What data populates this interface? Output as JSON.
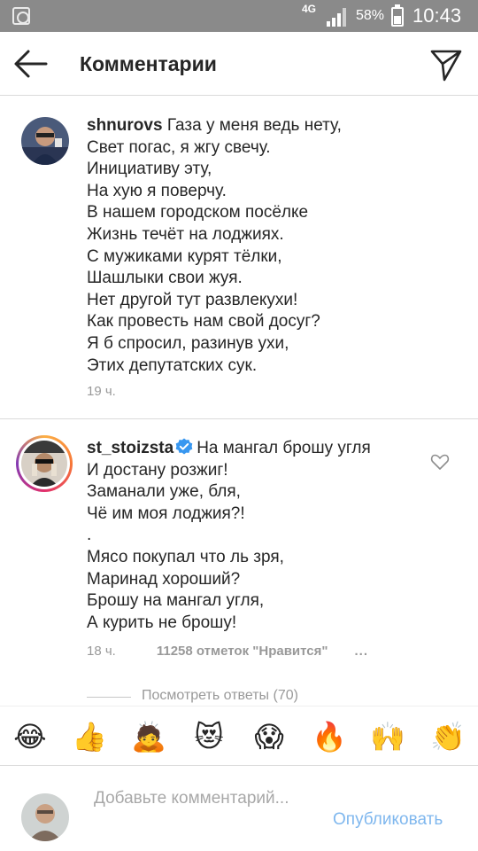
{
  "status_bar": {
    "network": "4G",
    "battery_percent": "58%",
    "time": "10:43"
  },
  "header": {
    "title": "Комментарии"
  },
  "comments": [
    {
      "username": "shnurovs",
      "text": "Газа у меня ведь нету,",
      "body": "Свет погас, я жгу свечу.\nИнициативу эту,\nНа хую я поверчу.\nВ нашем городском посёлке\nЖизнь течёт на лоджиях.\nС мужиками курят тёлки,\nШашлыки свои жуя.\nНет другой тут развлекухи!\nКак провесть нам свой досуг?\nЯ б спросил, разинув ухи,\nЭтих депутатских сук.",
      "time": "19 ч."
    },
    {
      "username": "st_stoizsta",
      "verified": true,
      "text": "На мангал брошу угля",
      "body": "И достану розжиг!\nЗаманали уже, бля,\nЧё им моя лоджия?!\n.\nМясо покупал что ль зря,\nМаринад хороший?\nБрошу на мангал угля,\nА курить не брошу!",
      "time": "18 ч.",
      "likes": "11258 отметок \"Нравится\"",
      "more": "...",
      "view_replies": "Посмотреть ответы (70)"
    }
  ],
  "emoji_bar": [
    {
      "icon": "face-with-tears-of-joy-icon",
      "glyph": "😂"
    },
    {
      "icon": "thumbs-up-icon",
      "glyph": "👍"
    },
    {
      "icon": "person-bowing-icon",
      "glyph": "🙇"
    },
    {
      "icon": "heart-eyes-cat-icon",
      "glyph": "😻"
    },
    {
      "icon": "face-screaming-icon",
      "glyph": "😱"
    },
    {
      "icon": "fire-icon",
      "glyph": "🔥"
    },
    {
      "icon": "person-raising-hands-icon",
      "glyph": "🙌"
    },
    {
      "icon": "clapping-hands-icon",
      "glyph": "👏"
    }
  ],
  "composer": {
    "placeholder": "Добавьте комментарий...",
    "post_label": "Опубликовать"
  },
  "colors": {
    "accent_link": "#7fb7ee",
    "verified_blue": "#3897f0",
    "status_bar": "#8a8a8a"
  }
}
